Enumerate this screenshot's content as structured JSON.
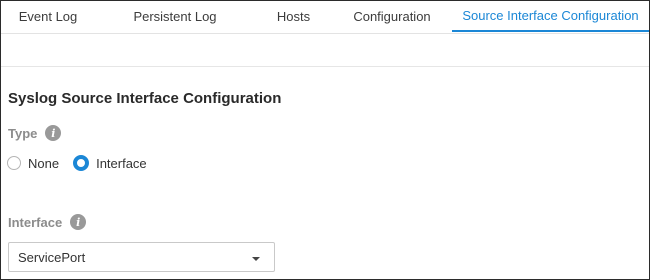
{
  "tabs": [
    {
      "label": "Event Log"
    },
    {
      "label": "Persistent Log"
    },
    {
      "label": "Hosts"
    },
    {
      "label": "Configuration"
    },
    {
      "label": "Source Interface Configuration",
      "active": true
    }
  ],
  "section": {
    "title": "Syslog Source Interface Configuration"
  },
  "type_field": {
    "label": "Type",
    "info_icon": "info-icon",
    "options": [
      {
        "label": "None",
        "selected": false
      },
      {
        "label": "Interface",
        "selected": true
      }
    ]
  },
  "interface_field": {
    "label": "Interface",
    "info_icon": "info-icon",
    "value": "ServicePort"
  },
  "colors": {
    "accent": "#1b87d6",
    "label_gray": "#8c8c8c"
  }
}
